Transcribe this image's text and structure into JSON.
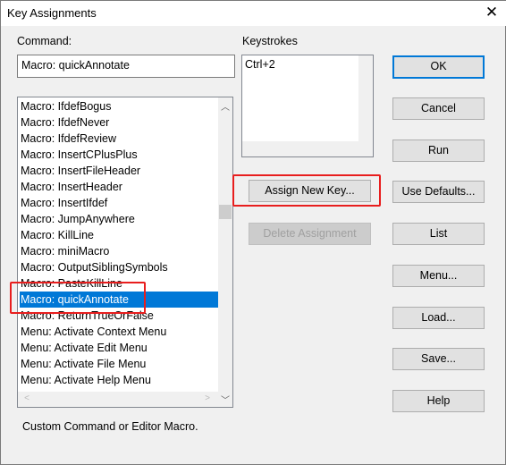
{
  "window": {
    "title": "Key Assignments",
    "close_icon": "close-icon"
  },
  "command": {
    "label": "Command:",
    "value": "Macro: quickAnnotate"
  },
  "commands_list": {
    "items": [
      "Macro: IfdefBogus",
      "Macro: IfdefNever",
      "Macro: IfdefReview",
      "Macro: InsertCPlusPlus",
      "Macro: InsertFileHeader",
      "Macro: InsertHeader",
      "Macro: InsertIfdef",
      "Macro: JumpAnywhere",
      "Macro: KillLine",
      "Macro: miniMacro",
      "Macro: OutputSiblingSymbols",
      "Macro: PasteKillLine",
      "Macro: quickAnnotate",
      "Macro: ReturnTrueOrFalse",
      "Menu: Activate Context Menu",
      "Menu: Activate Edit Menu",
      "Menu: Activate File Menu",
      "Menu: Activate Help Menu"
    ],
    "selected": "Macro: quickAnnotate"
  },
  "keystrokes": {
    "label": "Keystrokes",
    "items": [
      "Ctrl+2"
    ]
  },
  "buttons": {
    "assign": "Assign New Key...",
    "delete": "Delete Assignment",
    "ok": "OK",
    "cancel": "Cancel",
    "run": "Run",
    "use_defaults": "Use Defaults...",
    "list": "List",
    "menu": "Menu...",
    "load": "Load...",
    "save": "Save...",
    "help": "Help"
  },
  "description": "Custom Command or Editor Macro.",
  "colors": {
    "selection": "#0078d7",
    "highlight_box": "#e81e1e"
  }
}
